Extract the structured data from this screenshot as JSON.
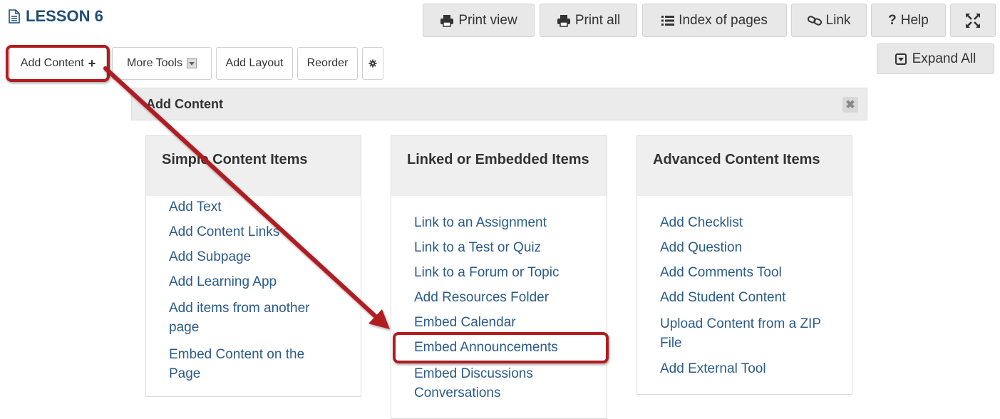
{
  "title": "LESSON 6",
  "toolbar": {
    "print_view": "Print view",
    "print_all": "Print all",
    "index_of_pages": "Index of pages",
    "link": "Link",
    "help": "Help",
    "help_prefix": "?",
    "expand_all": "Expand All"
  },
  "subtoolbar": {
    "add_content": "Add Content",
    "add_content_plus": "+",
    "more_tools": "More Tools",
    "add_layout": "Add Layout",
    "reorder": "Reorder"
  },
  "panel": {
    "title": "Add Content",
    "columns": [
      {
        "heading": "Simple Content Items",
        "items": [
          "Add Text",
          "Add Content Links",
          "Add Subpage",
          "Add Learning App",
          "Add items from another page",
          "Embed Content on the Page"
        ]
      },
      {
        "heading": "Linked or Embedded Items",
        "items": [
          "Link to an Assignment",
          "Link to a Test or Quiz",
          "Link to a Forum or Topic",
          "Add Resources Folder",
          "Embed Calendar",
          "Embed Announcements",
          "Embed Discussions Conversations"
        ]
      },
      {
        "heading": "Advanced Content Items",
        "items": [
          "Add Checklist",
          "Add Question",
          "Add Comments Tool",
          "Add Student Content",
          "Upload Content from a ZIP File",
          "Add External Tool"
        ]
      }
    ]
  },
  "colors": {
    "highlight": "#b01c20",
    "link": "#2a5b8a",
    "title": "#1f4e79"
  }
}
